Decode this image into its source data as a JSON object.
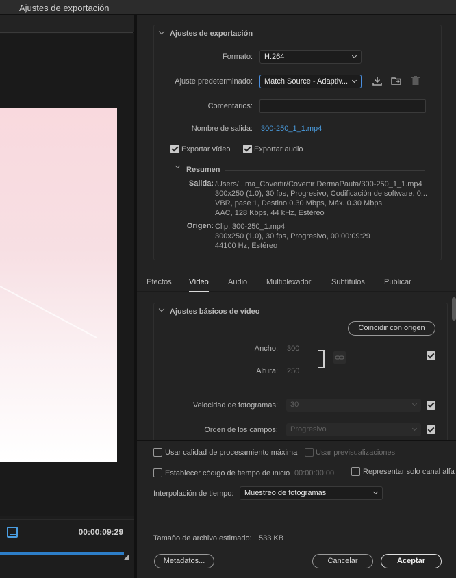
{
  "window": {
    "title": "Ajustes de exportación"
  },
  "preview": {
    "timecode": "00:00:09:29"
  },
  "export_settings": {
    "section_title": "Ajustes de exportación",
    "format_label": "Formato:",
    "format_value": "H.264",
    "preset_label": "Ajuste predeterminado:",
    "preset_value": "Match Source - Adaptiv...",
    "comments_label": "Comentarios:",
    "comments_value": "",
    "output_name_label": "Nombre de salida:",
    "output_name_value": "300-250_1_1.mp4",
    "export_video_label": "Exportar vídeo",
    "export_audio_label": "Exportar audio",
    "export_video_checked": true,
    "export_audio_checked": true,
    "summary": {
      "title": "Resumen",
      "output_label": "Salida:",
      "output_lines": [
        "/Users/...ma_Covertir/Covertir DermaPauta/300-250_1_1.mp4",
        "300x250 (1.0), 30 fps, Progresivo, Codificación de software, 0...",
        "VBR, pase 1, Destino 0.30 Mbps, Máx. 0.30 Mbps",
        "AAC, 128 Kbps, 44 kHz, Estéreo"
      ],
      "source_label": "Origen:",
      "source_lines": [
        "Clip, 300-250_1.mp4",
        "300x250 (1.0), 30 fps, Progresivo, 00:00:09:29",
        "44100 Hz, Estéreo"
      ]
    }
  },
  "tabs": [
    {
      "label": "Efectos"
    },
    {
      "label": "Vídeo",
      "active": true
    },
    {
      "label": "Audio"
    },
    {
      "label": "Multiplexador"
    },
    {
      "label": "Subtítulos"
    },
    {
      "label": "Publicar"
    }
  ],
  "video_basic": {
    "section_title": "Ajustes básicos de vídeo",
    "match_source_label": "Coincidir con origen",
    "width_label": "Ancho:",
    "width_value": "300",
    "height_label": "Altura:",
    "height_value": "250",
    "frame_rate_label": "Velocidad de fotogramas:",
    "frame_rate_value": "30",
    "field_order_label": "Orden de los campos:",
    "field_order_value": "Progresivo"
  },
  "bottom": {
    "max_render_quality_label": "Usar calidad de procesamiento máxima",
    "use_previews_label": "Usar previsualizaciones",
    "start_timecode_label": "Establecer código de tiempo de inicio",
    "start_timecode_value": "00:00:00:00",
    "alpha_only_label": "Representar solo canal alfa",
    "time_interpolation_label": "Interpolación de tiempo:",
    "time_interpolation_value": "Muestreo de fotogramas",
    "file_size_label": "Tamaño de archivo estimado:",
    "file_size_value": "533 KB",
    "metadata_button": "Metadatos...",
    "cancel_button": "Cancelar",
    "accept_button": "Aceptar"
  },
  "colors": {
    "accent": "#4a9de0",
    "timeline_bar": "#2d7ec8",
    "background": "#232323"
  }
}
